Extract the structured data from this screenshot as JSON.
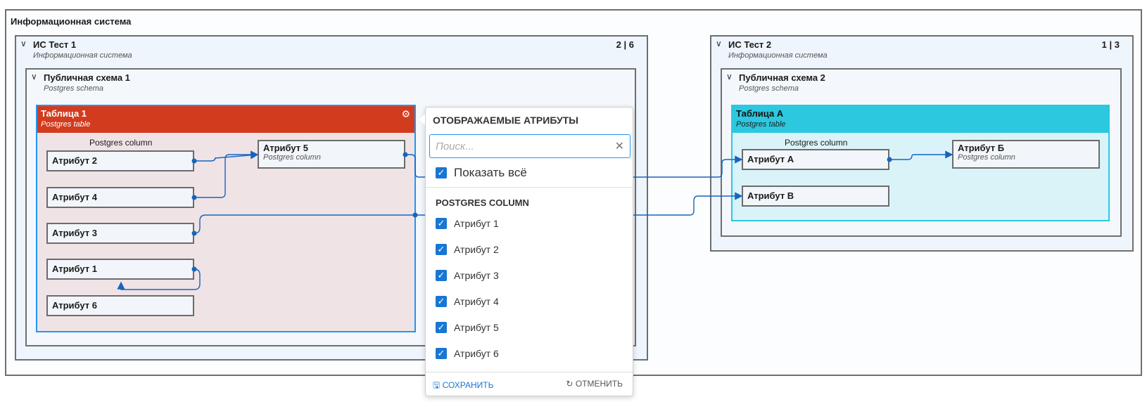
{
  "root": {
    "title": "Информационная система"
  },
  "is1": {
    "title": "ИС Тест 1",
    "subtitle": "Информационная система",
    "count": "2 | 6"
  },
  "schema1": {
    "title": "Публичная схема 1",
    "subtitle": "Postgres schema"
  },
  "table1": {
    "title": "Таблица 1",
    "subtitle": "Postgres table",
    "group_label": "Postgres column",
    "header_color": "#d23b1e",
    "attrs": [
      "Атрибут 2",
      "Атрибут 4",
      "Атрибут 3",
      "Атрибут 1",
      "Атрибут 6"
    ],
    "attr5": {
      "name": "Атрибут 5",
      "type": "Postgres column"
    }
  },
  "is2": {
    "title": "ИС Тест 2",
    "subtitle": "Информационная система",
    "count": "1 | 3"
  },
  "schema2": {
    "title": "Публичная схема 2",
    "subtitle": "Postgres schema"
  },
  "tableA": {
    "title": "Таблица А",
    "subtitle": "Postgres table",
    "group_label": "Postgres column",
    "header_color": "#2bc8e0",
    "attrs": [
      "Атрибут А",
      "Атрибут В"
    ],
    "attrB": {
      "name": "Атрибут Б",
      "type": "Postgres column"
    }
  },
  "popup": {
    "title": "ОТОБРАЖАЕМЫЕ АТРИБУТЫ",
    "search_placeholder": "Поиск...",
    "show_all": "Показать всё",
    "group": "POSTGRES COLUMN",
    "items": [
      "Атрибут 1",
      "Атрибут 2",
      "Атрибут 3",
      "Атрибут 4",
      "Атрибут 5",
      "Атрибут 6"
    ],
    "save": "СОХРАНИТЬ",
    "cancel": "ОТМЕНИТЬ"
  },
  "colors": {
    "link": "#1565c0",
    "accent": "#1976d2"
  }
}
